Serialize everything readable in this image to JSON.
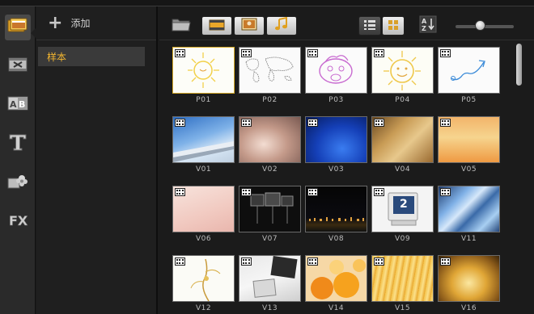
{
  "rail": {
    "items": [
      {
        "name": "media-library",
        "icon": "library-icon",
        "active": true
      },
      {
        "name": "transitions",
        "icon": "transition-icon",
        "active": false
      },
      {
        "name": "titles-ab",
        "icon": "ab-icon",
        "label": "AB"
      },
      {
        "name": "text",
        "icon": "title-icon",
        "label": "T"
      },
      {
        "name": "graphics",
        "icon": "graphics-icon",
        "active": false
      },
      {
        "name": "filters",
        "icon": "fx-icon",
        "label": "FX"
      }
    ]
  },
  "library": {
    "add_label": "添加",
    "items": [
      {
        "label": "样本",
        "selected": true
      }
    ]
  },
  "toolbar": {
    "buttons": [
      "open-folder-icon",
      "video-filter-icon",
      "photo-filter-icon",
      "audio-filter-icon",
      "list-view-icon",
      "thumbnail-view-icon",
      "sort-icon"
    ],
    "zoom_level": 0.38
  },
  "clips": [
    {
      "label": "P01",
      "selected": true
    },
    {
      "label": "P02"
    },
    {
      "label": "P03"
    },
    {
      "label": "P04"
    },
    {
      "label": "P05"
    },
    {
      "label": "V01"
    },
    {
      "label": "V02"
    },
    {
      "label": "V03"
    },
    {
      "label": "V04"
    },
    {
      "label": "V05"
    },
    {
      "label": "V06"
    },
    {
      "label": "V07"
    },
    {
      "label": "V08"
    },
    {
      "label": "V09",
      "screen_digit": "2"
    },
    {
      "label": "V11"
    },
    {
      "label": "V12"
    },
    {
      "label": "V13"
    },
    {
      "label": "V14"
    },
    {
      "label": "V15"
    },
    {
      "label": "V16"
    }
  ],
  "colors": {
    "accent": "#f2b530",
    "selected_border": "#d7aa28"
  }
}
